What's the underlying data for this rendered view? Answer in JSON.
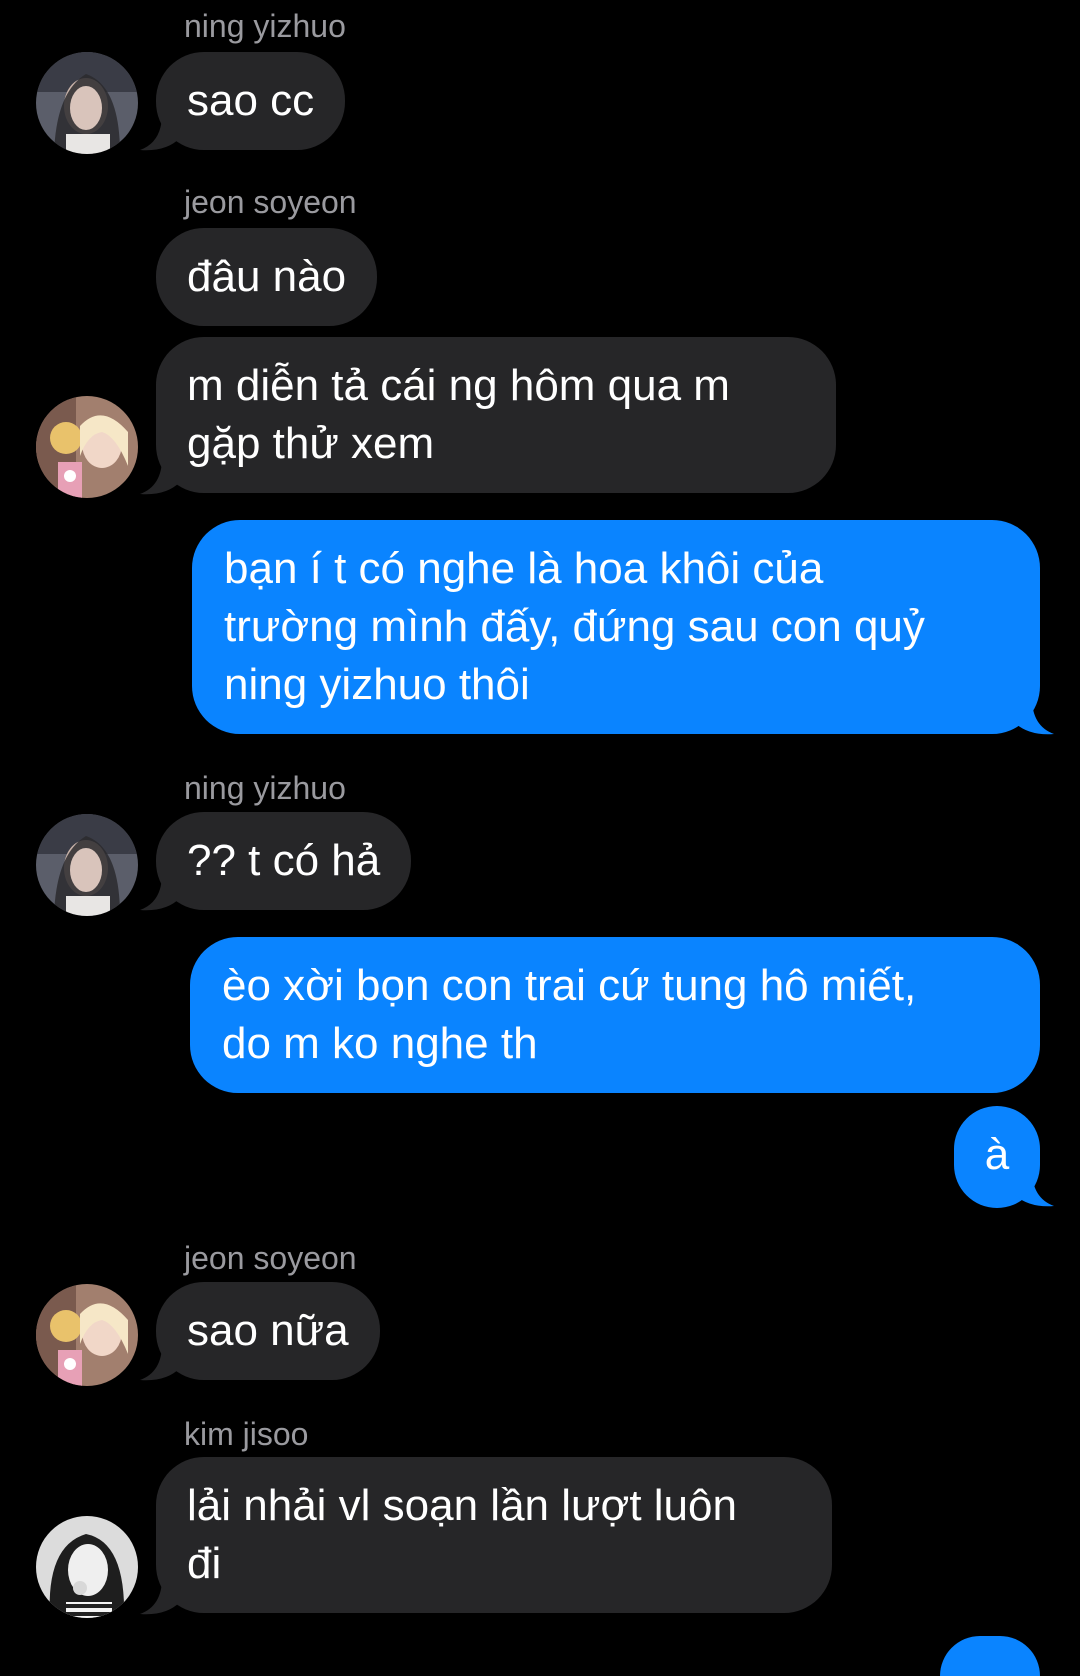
{
  "colors": {
    "background": "#000000",
    "incoming_bubble": "#262628",
    "outgoing_bubble": "#0a84ff",
    "sender_name": "#9a9a9f",
    "message_text": "#ffffff"
  },
  "messages": [
    {
      "direction": "incoming",
      "sender": "ning yizhuo",
      "avatar": "avatar-ning-yizhuo",
      "text": "sao cc"
    },
    {
      "direction": "incoming",
      "sender": "jeon soyeon",
      "avatar": null,
      "text": "đâu nào"
    },
    {
      "direction": "incoming",
      "sender": null,
      "avatar": "avatar-jeon-soyeon",
      "text": "m diễn tả cái ng hôm qua m\ngặp thử xem"
    },
    {
      "direction": "outgoing",
      "text": "bạn í t có nghe là hoa khôi của\ntrường mình đấy, đứng sau con quỷ\nning yizhuo thôi"
    },
    {
      "direction": "incoming",
      "sender": "ning yizhuo",
      "avatar": "avatar-ning-yizhuo",
      "text": "?? t có hả"
    },
    {
      "direction": "outgoing",
      "text": "èo xời bọn con trai cứ tung hô miết,\ndo m ko nghe th"
    },
    {
      "direction": "outgoing",
      "text": "à"
    },
    {
      "direction": "incoming",
      "sender": "jeon soyeon",
      "avatar": "avatar-jeon-soyeon",
      "text": "sao nữa"
    },
    {
      "direction": "incoming",
      "sender": "kim jisoo",
      "avatar": "avatar-kim-jisoo",
      "text": "lải nhải vl soạn lần lượt luôn\nđi"
    }
  ]
}
